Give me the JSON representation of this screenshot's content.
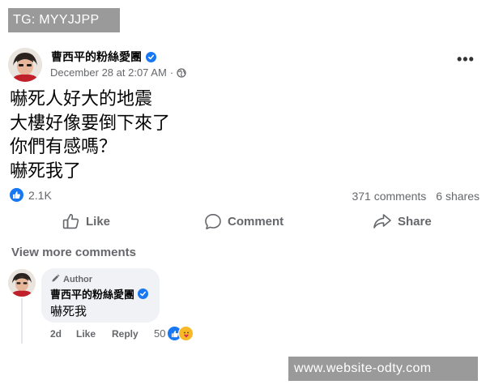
{
  "watermark_top": "TG: MYYJJPP",
  "watermark_bottom": "www.website-odty.com",
  "post": {
    "author": "曹西平的粉絲愛團",
    "timestamp": "December 28 at 2:07 AM",
    "privacy_separator": "·",
    "privacy_icon": "globe-icon",
    "more_label": "•••",
    "lines": [
      "嚇死人好大的地震",
      "大樓好像要倒下來了",
      "你們有感嗎？",
      "嚇死我了"
    ],
    "reaction_icon": "like-icon",
    "reaction_count": "2.1K",
    "comments_count": "371 comments",
    "shares_count": "6 shares"
  },
  "actions": {
    "like": "Like",
    "comment": "Comment",
    "share": "Share"
  },
  "comments": {
    "view_more": "View more comments",
    "items": [
      {
        "badge": "Author",
        "name": "曹西平的粉絲愛團",
        "text": "嚇死我",
        "time": "2d",
        "like_label": "Like",
        "reply_label": "Reply",
        "reaction_count": "50",
        "reaction_icons": [
          "like-icon",
          "care-icon"
        ]
      }
    ]
  },
  "colors": {
    "accent": "#1877f2",
    "secondary_text": "#65676b",
    "bubble_bg": "#f0f2f5"
  }
}
